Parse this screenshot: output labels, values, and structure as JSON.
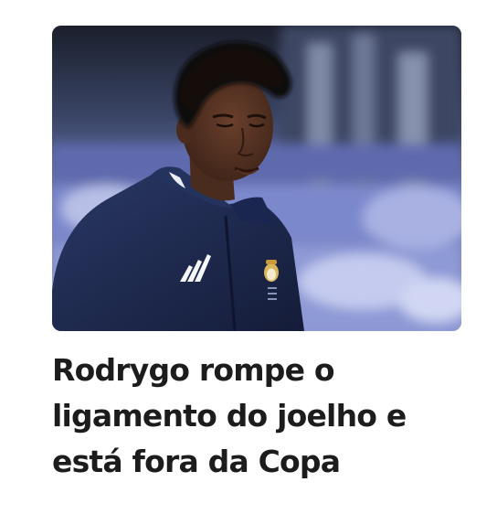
{
  "article": {
    "image_subject": "person-photo",
    "headline": "Rodrygo rompe o ligamento do joelho e está fora da Copa"
  },
  "colors": {
    "headline_text": "#1c1c1c",
    "background": "#ffffff",
    "jacket": "#1f2a4f"
  }
}
